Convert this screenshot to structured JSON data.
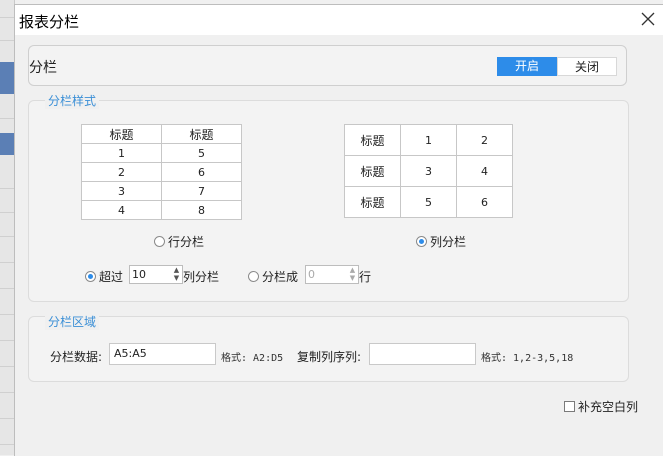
{
  "dialog": {
    "title": "报表分栏"
  },
  "toggle": {
    "label": "分栏",
    "on": "开启",
    "off": "关闭"
  },
  "style_group": {
    "title": "分栏样式",
    "row_table": {
      "headers": [
        "标题",
        "标题"
      ],
      "rows": [
        [
          "1",
          "5"
        ],
        [
          "2",
          "6"
        ],
        [
          "3",
          "7"
        ],
        [
          "4",
          "8"
        ]
      ]
    },
    "col_table": {
      "rows": [
        [
          "标题",
          "1",
          "2"
        ],
        [
          "标题",
          "3",
          "4"
        ],
        [
          "标题",
          "5",
          "6"
        ]
      ]
    },
    "row_option": "行分栏",
    "col_option": "列分栏",
    "exceed_label": "超过",
    "exceed_value": "10",
    "exceed_suffix": "列分栏",
    "split_label": "分栏成",
    "split_value": "0",
    "split_suffix": "行"
  },
  "area_group": {
    "title": "分栏区域",
    "data_label": "分栏数据:",
    "data_value": "A5:A5",
    "data_hint": "格式: A2:D5",
    "copy_label": "复制列序列:",
    "copy_value": "",
    "copy_hint": "格式: 1,2-3,5,18"
  },
  "fill_empty": {
    "label": "补充空白列",
    "checked": false
  },
  "colors": {
    "accent": "#2d8ce9",
    "group_title": "#3b8fd6"
  }
}
